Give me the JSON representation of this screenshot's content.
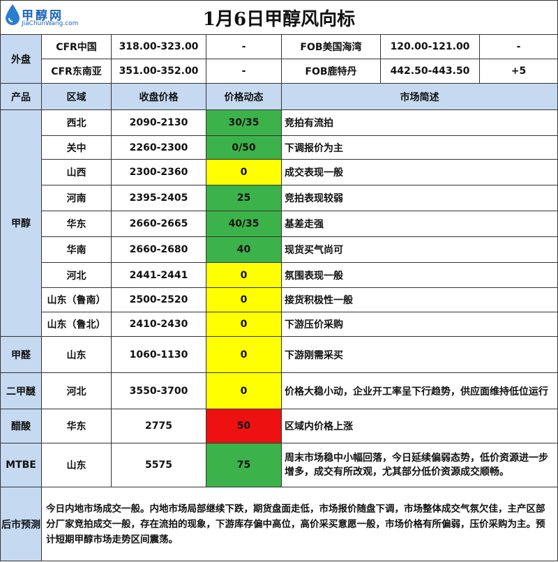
{
  "title": "1月6日甲醇风向标",
  "logo": {
    "cn": "甲醇网",
    "en": "JiaChunWang.com"
  },
  "outer": {
    "label": "外盘",
    "rows": [
      {
        "name1": "CFR中国",
        "price1": "318.00-323.00",
        "change1": "-",
        "name2": "FOB美国海湾",
        "price2": "120.00-121.00",
        "change2": "-"
      },
      {
        "name1": "CFR东南亚",
        "price1": "351.00-352.00",
        "change1": "-",
        "name2": "FOB鹿特丹",
        "price2": "442.50-443.50",
        "change2": "+5"
      }
    ]
  },
  "headers": {
    "product": "产品",
    "region": "区域",
    "close": "收盘价格",
    "dynamic": "价格动态",
    "desc": "市场简述"
  },
  "products": [
    {
      "product": "甲醇",
      "rows": [
        {
          "region": "西北",
          "price": "2090-2130",
          "change": "30/35",
          "color": "green",
          "desc": "竞拍有流拍"
        },
        {
          "region": "关中",
          "price": "2260-2300",
          "change": "0/50",
          "color": "green",
          "desc": "下调报价为主"
        },
        {
          "region": "山西",
          "price": "2300-2360",
          "change": "0",
          "color": "yellow",
          "desc": "成交表现一般"
        },
        {
          "region": "河南",
          "price": "2395-2405",
          "change": "25",
          "color": "green",
          "desc": "竞拍表现较弱"
        },
        {
          "region": "华东",
          "price": "2660-2665",
          "change": "40/35",
          "color": "green",
          "desc": "基差走强"
        },
        {
          "region": "华南",
          "price": "2660-2680",
          "change": "40",
          "color": "green",
          "desc": "现货买气尚可"
        },
        {
          "region": "河北",
          "price": "2441-2441",
          "change": "0",
          "color": "yellow",
          "desc": "氛围表现一般"
        },
        {
          "region": "山东（鲁南）",
          "price": "2500-2520",
          "change": "0",
          "color": "yellow",
          "desc": "接货积极性一般"
        },
        {
          "region": "山东（鲁北）",
          "price": "2410-2430",
          "change": "0",
          "color": "yellow",
          "desc": "下游压价采购"
        }
      ]
    },
    {
      "product": "甲醛",
      "rows": [
        {
          "region": "山东",
          "price": "1060-1130",
          "change": "0",
          "color": "yellow",
          "desc": "下游刚需采买"
        }
      ]
    },
    {
      "product": "二甲醚",
      "rows": [
        {
          "region": "河北",
          "price": "3550-3700",
          "change": "0",
          "color": "yellow",
          "desc": "价格大稳小动，企业开工率呈下行趋势，供应面维持低位运行"
        }
      ]
    },
    {
      "product": "醋酸",
      "rows": [
        {
          "region": "华东",
          "price": "2775",
          "change": "50",
          "color": "red",
          "desc": "区域内价格上涨"
        }
      ]
    },
    {
      "product": "MTBE",
      "rows": [
        {
          "region": "山东",
          "price": "5575",
          "change": "75",
          "color": "green",
          "desc": "周末市场稳中小幅回落，今日延续偏弱态势，低价资源进一步增多，成交有所改观，尤其部分低价资源成交顺畅。"
        }
      ]
    }
  ],
  "forecast": {
    "label": "后市预测",
    "text": "今日内地市场成交一般。内地市场局部继续下跌，期货盘面走低，市场报价随盘下调，市场整体成交气氛欠佳，主产区部分厂家竞拍成交一般，存在流拍的现象，下游库存偏中高位，高价采买意愿一般，市场价格有所偏弱，压价采购为主。预计短期甲醇市场走势区间震荡。"
  },
  "colors": {
    "header_bg": "#c5d9f1",
    "up": "#3cb34a",
    "flat": "#ffff00",
    "hot": "#ee1111"
  }
}
